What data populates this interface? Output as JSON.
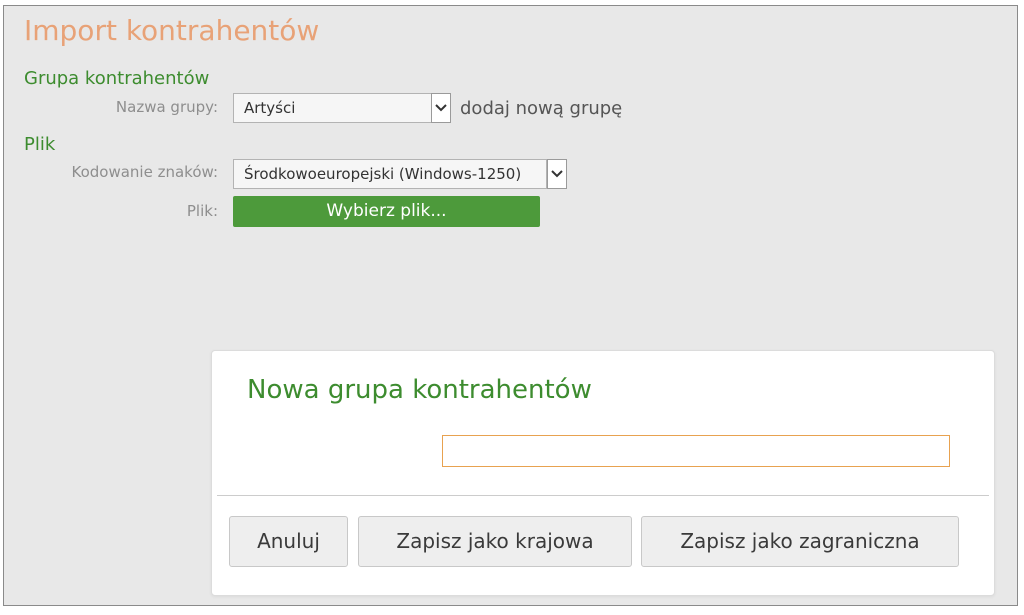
{
  "page": {
    "title": "Import kontrahentów"
  },
  "group_section": {
    "heading": "Grupa kontrahentów",
    "name_label": "Nazwa grupy:",
    "name_value": "Artyści",
    "add_link": "dodaj nową grupę"
  },
  "file_section": {
    "heading": "Plik",
    "encoding_label": "Kodowanie znaków:",
    "encoding_value": "Środkowoeuropejski (Windows-1250)",
    "file_label": "Plik:",
    "choose_button": "Wybierz plik..."
  },
  "dialog": {
    "title": "Nowa grupa kontrahentów",
    "input_value": "",
    "buttons": {
      "cancel": "Anuluj",
      "save_domestic": "Zapisz jako krajowa",
      "save_foreign": "Zapisz jako zagraniczna"
    }
  },
  "icons": {
    "select_caret": "chevron-down-icon"
  },
  "colors": {
    "title": "#e8a277",
    "section_heading": "#3d8c2f",
    "primary_button": "#4d9a3b",
    "input_focus_border": "#e8a250"
  }
}
